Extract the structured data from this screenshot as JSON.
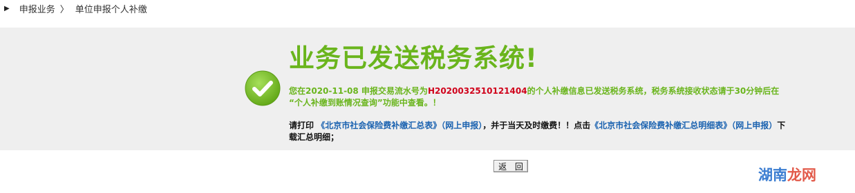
{
  "breadcrumb": {
    "arrow_icon": "triangle-right-icon",
    "level1": "申报业务",
    "separator": "〉",
    "level2": "单位申报个人补缴"
  },
  "result": {
    "title": "业务已发送税务系统!",
    "icon": "check-circle-icon",
    "icon_color": "#7ec52a",
    "message_prefix": "您在2020-11-08 申报交易流水号为",
    "serial_number": "H2020032510121404",
    "message_suffix": "的个人补缴信息已发送税务系统，税务系统接收状态请于30分钟后在 “个人补缴到账情况查询”功能中查看。！",
    "print_prefix": "请打印",
    "summary_link": "《北京市社会保险费补缴汇总表》（网上申报）",
    "print_middle": "，并于当天及时缴费！！点击",
    "detail_link": "《北京市社会保险费补缴汇总明细表》（网上申报）",
    "print_suffix": "下载汇总明细；"
  },
  "back_button": {
    "label": "返 回"
  },
  "watermark": {
    "part1": "湖南",
    "part2": "龙网"
  },
  "colors": {
    "accent_green": "#6ab51d",
    "serial_red": "#d0021b",
    "link_blue": "#1a62b0",
    "panel_bg": "#efefef"
  }
}
